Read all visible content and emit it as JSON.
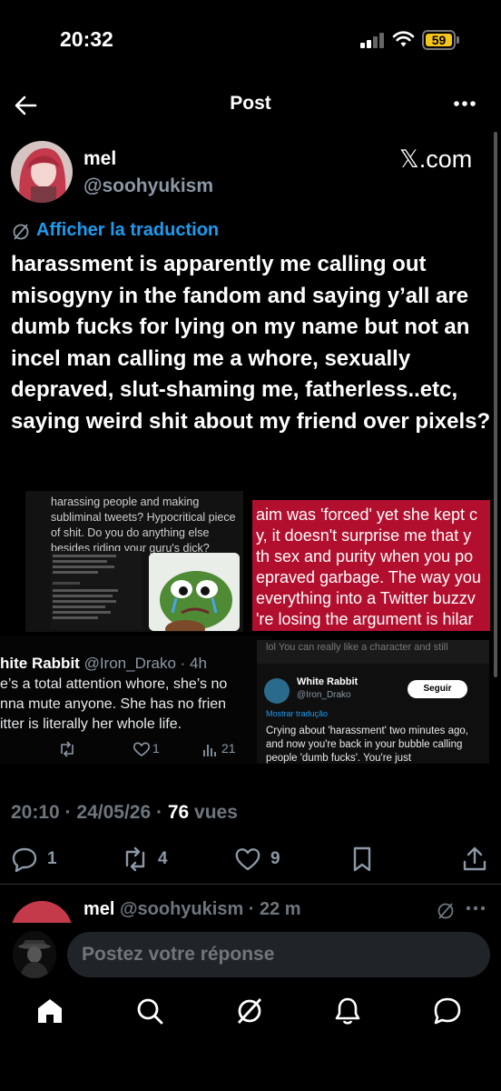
{
  "status_bar": {
    "time": "20:32",
    "battery": "59"
  },
  "header": {
    "title": "Post"
  },
  "author": {
    "name": "mel",
    "handle": "@soohyukism",
    "source": "𝕏.com"
  },
  "translate_label": "Afficher la traduction",
  "post_text": "harassment is apparently me calling out misogyny in the fandom and saying y’all are dumb fucks for lying on my name but not an incel man calling me a whore, sexually depraved, slut-shaming me, fatherless..etc, saying weird shit about my friend over pixels?",
  "media": {
    "shot_a_text": "harassing people and making subliminal tweets? Hypocritical piece of shit. Do you do anything else besides riding your guru's dick?",
    "shot_b_lines": [
      "aim was 'forced' yet she kept c",
      "y, it doesn't surprise me that y",
      "th sex and purity when you po",
      "epraved garbage. The way you",
      "everything into a Twitter buzzv",
      "'re losing the argument is hilar"
    ],
    "shot_c": {
      "name": "hite Rabbit",
      "handle": "@Iron_Drako · 4h",
      "lines": [
        "e’s a total attention whore, she’s no",
        "nna mute  anyone. She has no frien",
        "itter is literally her whole life."
      ],
      "likes": "1",
      "views": "21"
    },
    "shot_d": {
      "blur_text": "lol  You can really like a character and still",
      "name": "White Rabbit",
      "handle": "@Iron_Drako",
      "follow": "Seguir",
      "translate": "Mostrar tradução",
      "body": "Crying about 'harassment' two minutes ago, and now you're back in your bubble calling people 'dumb fucks'. You're just"
    }
  },
  "meta": {
    "time": "20:10",
    "date": "24/05/26",
    "views": "76",
    "views_label": "vues"
  },
  "actions": {
    "replies": "1",
    "reposts": "4",
    "likes": "9"
  },
  "reply_preview": {
    "name": "mel",
    "handle_time": "@soohyukism · 22 m"
  },
  "composer": {
    "placeholder": "Postez votre réponse"
  }
}
